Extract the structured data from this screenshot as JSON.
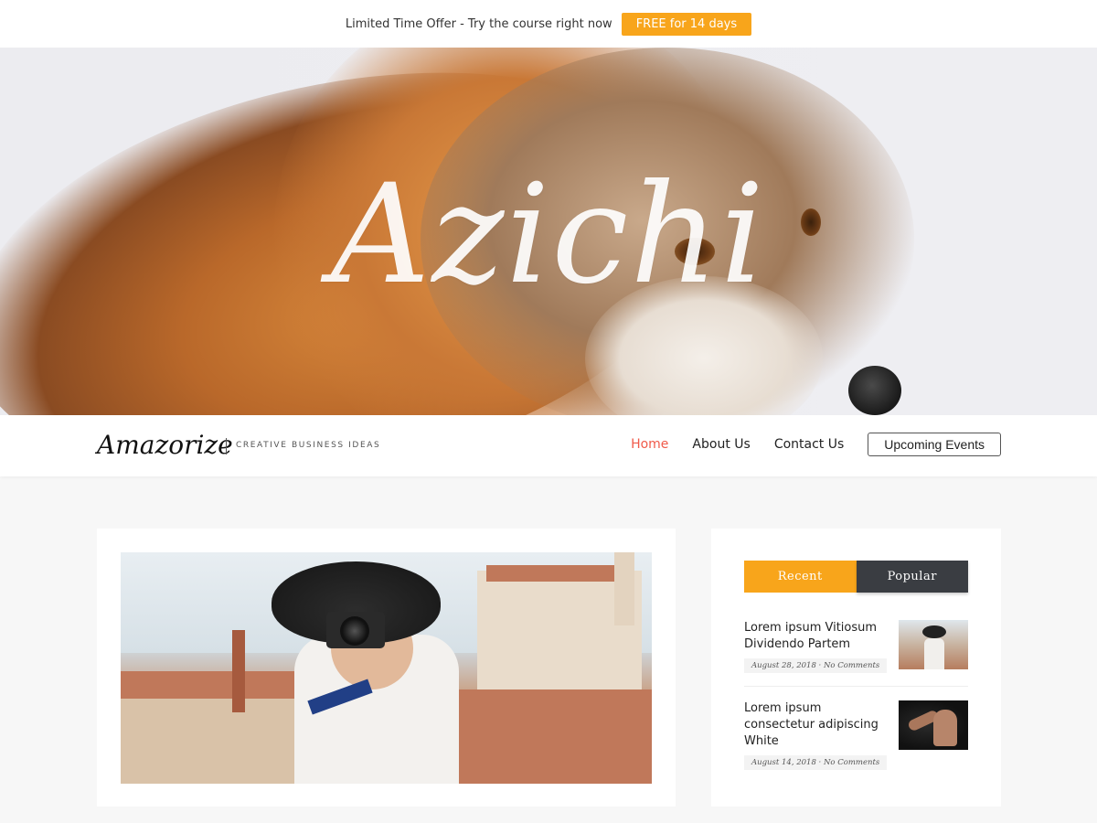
{
  "offer": {
    "text": "Limited Time Offer - Try the course right now",
    "button": "FREE for 14 days"
  },
  "hero": {
    "title": "Azichi"
  },
  "nav": {
    "brand": "Amazorize",
    "tagline": "CREATIVE BUSINESS IDEAS",
    "links": [
      "Home",
      "About Us",
      "Contact Us"
    ],
    "cta": "Upcoming Events"
  },
  "sidebar": {
    "tabs": [
      "Recent",
      "Popular"
    ],
    "posts": [
      {
        "title": "Lorem ipsum Vitiosum Dividendo Partem",
        "meta": "August 28, 2018 · No Comments"
      },
      {
        "title": "Lorem ipsum consectetur adipiscing White",
        "meta": "August 14, 2018 · No Comments"
      }
    ]
  },
  "colors": {
    "accent": "#f8a51b",
    "active_link": "#f05a4a",
    "dark_tab": "#3a3d42"
  }
}
